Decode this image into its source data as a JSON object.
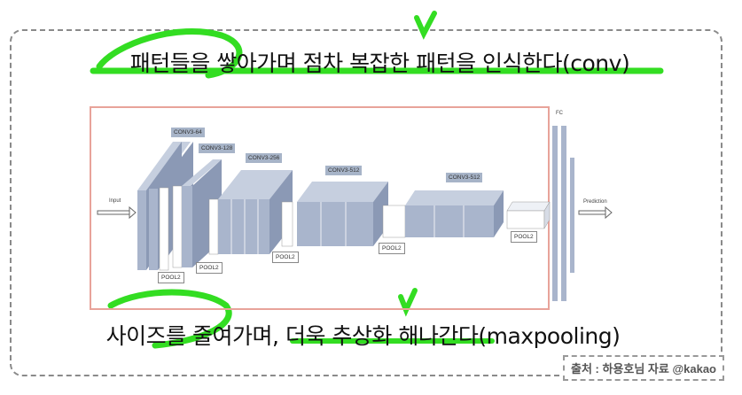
{
  "text": {
    "top_caption": "패턴들을 쌓아가며 점차 복잡한 패턴을 인식한다(conv)",
    "bottom_caption": "사이즈를 줄여가며, 더욱 추상화 해나간다(maxpooling)",
    "source": "출처 : 하용호님 자료 @kakao"
  },
  "diagram": {
    "input_label": "Input",
    "output_label": "Prediction",
    "fc_label": "FC",
    "conv_labels": [
      "CONV3-64",
      "CONV3-128",
      "CONV3-256",
      "CONV3-512",
      "CONV3-512"
    ],
    "pool_label": "POOL2"
  },
  "colors": {
    "highlight": "#33dd22",
    "block": "#a9b5cc",
    "block_dark": "#8b99b5",
    "frame": "#8a8a8a"
  }
}
